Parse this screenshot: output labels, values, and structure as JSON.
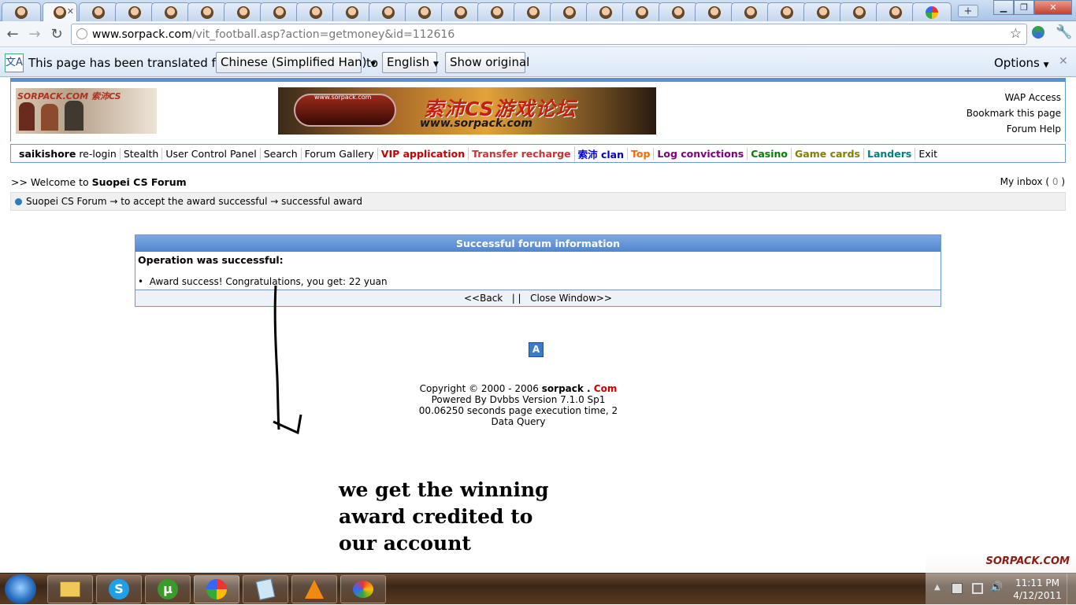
{
  "browser": {
    "address_host": "www.sorpack.com",
    "address_path": "/vit_football.asp?action=getmoney&id=112616",
    "new_tab_label": "+"
  },
  "translate_bar": {
    "message": "This page has been translated from",
    "from_language": "Chinese (Simplified Han)",
    "to_word": "to",
    "to_language": "English",
    "show_original": "Show original",
    "options": "Options",
    "close": "✕"
  },
  "forum": {
    "header_links": [
      "WAP Access",
      "Bookmark this page",
      "Forum Help"
    ],
    "logo_text": "SORPACK.COM 索沛CS",
    "banner_url_text": "www.sorpack.com",
    "banner_title": "索沛CS游戏论坛",
    "banner_sub": "www.sorpack.com",
    "nav": {
      "username": "saikishore",
      "items": [
        {
          "label": "re-login",
          "color": "#000000",
          "bold": false
        },
        {
          "label": "Stealth",
          "color": "#000000",
          "bold": false
        },
        {
          "label": "User Control Panel",
          "color": "#000000",
          "bold": false
        },
        {
          "label": "Search",
          "color": "#000000",
          "bold": false
        },
        {
          "label": "Forum Gallery",
          "color": "#000000",
          "bold": false
        },
        {
          "label": "VIP application",
          "color": "#cc0000",
          "bold": true
        },
        {
          "label": "Transfer recharge",
          "color": "#cc3333",
          "bold": true
        },
        {
          "label": "索沛 clan",
          "color": "#0000cc",
          "bold": true
        },
        {
          "label": "Top",
          "color": "#ff6600",
          "bold": true
        },
        {
          "label": "Log convictions",
          "color": "#800080",
          "bold": true
        },
        {
          "label": "Casino",
          "color": "#008000",
          "bold": true
        },
        {
          "label": "Game cards",
          "color": "#808000",
          "bold": true
        },
        {
          "label": "Landers",
          "color": "#008080",
          "bold": true
        },
        {
          "label": "Exit",
          "color": "#000000",
          "bold": false
        }
      ]
    },
    "welcome_prefix": ">> Welcome to",
    "welcome_forum": "Suopei CS Forum",
    "inbox_label": "My inbox (",
    "inbox_count": "0",
    "inbox_close": ")",
    "breadcrumb": "Suopei CS Forum → to accept the award successful → successful award",
    "info_box": {
      "title": "Successful forum information",
      "status": "Operation was successful:",
      "message": "Award success! Congratulations, you get: 22 yuan",
      "back": "<<Back",
      "separator": "| |",
      "close": "Close Window>>"
    },
    "footer": {
      "copyright": "Copyright © 2000 - 2006",
      "brand": "sorpack",
      "dot": " . ",
      "tld": "Com",
      "powered": "Powered By Dvbbs Version 7.1.0 Sp1",
      "exec_time": "00.06250 seconds page execution time, 2",
      "query": "Data Query",
      "badge": "A"
    }
  },
  "annotation": {
    "lines": [
      "we get the winning",
      "award credited to",
      "our account"
    ]
  },
  "taskbar": {
    "time": "11:11 PM",
    "date": "4/12/2011",
    "watermark": "SORPACK.COM"
  }
}
